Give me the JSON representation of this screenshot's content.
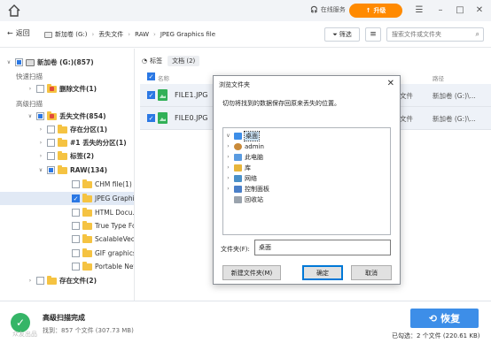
{
  "titlebar": {
    "online_label": "在线服务",
    "upgrade_label": "升级"
  },
  "toolbar": {
    "back_label": "返回",
    "breadcrumb": [
      "新加卷 (G:)",
      "丢失文件",
      "RAW",
      "JPEG Graphics file"
    ],
    "filter_label": "筛选",
    "search_placeholder": "搜索文件或文件夹"
  },
  "sidebar": {
    "root_label": "新加卷 (G:)(857)",
    "quick_scan_label": "快速扫描",
    "deleted_files_label": "删除文件(1)",
    "deep_scan_label": "高级扫描",
    "lost_files_label": "丢失文件(854)",
    "existing_partition_label": "存在分区(1)",
    "lost_partition_label": "#1 丢失的分区(1)",
    "tags_label": "标签(2)",
    "raw_label": "RAW(134)",
    "raw_children": [
      "CHM file(1)",
      "JPEG Graphi...",
      "HTML Docu...",
      "True Type Fo...",
      "ScalableVect...",
      "GIF graphics...",
      "Portable Net..."
    ],
    "existing_files_label": "存在文件(2)"
  },
  "main": {
    "tag_tab_label": "标签",
    "doc_tab_label": "文档 (2)",
    "col_name": "名称",
    "col_path": "路径",
    "rows": [
      {
        "name": "FILE1.JPG",
        "ext": "文件",
        "path": "新加卷 (G:)\\..."
      },
      {
        "name": "FILE0.JPG",
        "ext": "文件",
        "path": "新加卷 (G:)\\..."
      }
    ]
  },
  "bottom": {
    "status_title": "高级扫描完成",
    "status_sub": "找到：857 个文件 (307.73 MB)",
    "recover_label": "恢复",
    "selected_info": "已勾选：2 个文件 (220.61 KB)",
    "watermark": "众友出品"
  },
  "dialog": {
    "title": "浏览文件夹",
    "message": "切勿将找到的数据保存回原来丢失的位置。",
    "folders": [
      {
        "label": "桌面",
        "expanded": true,
        "selected": true,
        "icon_color": "#3d8ee8"
      },
      {
        "label": "admin",
        "expanded": false,
        "icon_color": "#c98a3a"
      },
      {
        "label": "此电脑",
        "expanded": false,
        "icon_color": "#5a9be0"
      },
      {
        "label": "库",
        "expanded": false,
        "icon_color": "#e7b53b"
      },
      {
        "label": "网络",
        "expanded": false,
        "icon_color": "#4a90c8"
      },
      {
        "label": "控制面板",
        "expanded": false,
        "icon_color": "#4a7fc8"
      },
      {
        "label": "回收站",
        "expanded": false,
        "icon_color": "#9aa3ad"
      }
    ],
    "folder_name_label": "文件夹(F):",
    "folder_name_value": "桌面",
    "new_folder_label": "新建文件夹(M)",
    "ok_label": "确定",
    "cancel_label": "取消"
  }
}
